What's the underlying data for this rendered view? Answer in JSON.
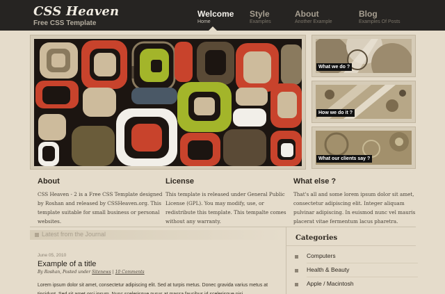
{
  "site": {
    "title": "CSS Heaven",
    "subtitle": "Free CSS Template"
  },
  "nav": [
    {
      "label": "Welcome",
      "sub": "Home",
      "active": true
    },
    {
      "label": "Style",
      "sub": "Examples"
    },
    {
      "label": "About",
      "sub": "Another Example"
    },
    {
      "label": "Blog",
      "sub": "Examples Of Posts"
    }
  ],
  "features": [
    {
      "caption": "What we do ?"
    },
    {
      "caption": "How we do it ?"
    },
    {
      "caption": "What our clients say ?"
    }
  ],
  "columns": [
    {
      "heading": "About",
      "text": "CSS Heaven - 2 is a Free CSS Template designed by Roshan and released by CSSHeaven.org. This template suitable for small business or personal websites."
    },
    {
      "heading": "License",
      "text": "This template is released under General Public License (GPL). You may modify, use, or redistribute this template. This tempalte comes without any warranty."
    },
    {
      "heading": "What else ?",
      "text": "That's all and some lorem ipsum dolor sit amet, consectetur adipiscing elit. Integer aliquam pulvinar adipiscing. In euismod nunc vel mauris placerat vitae fermentum lacus pharetra."
    }
  ],
  "journal": {
    "heading": "Latest from the Journal",
    "post": {
      "date": "June 05, 2010",
      "title": "Example of a title",
      "meta_prefix": "By Roshan, Posted under ",
      "category": "Sitenews",
      "separator": " | ",
      "comments": "10 Comments",
      "body": "Lorem ipsum dolor sit amet, consectetur adipiscing elit. Sed at turpis metus. Donec gravida varius metus at tincidunt. Sed sit amet orci ipsum. Nunc scelerisque purus at massa faucibus id scelerisque nisi."
    }
  },
  "sidebar": {
    "title": "Categories",
    "items": [
      {
        "label": "Computers"
      },
      {
        "label": "Health & Beauty"
      },
      {
        "label": "Apple / Macintosh"
      }
    ]
  },
  "colors": {
    "header": "#262422",
    "page": "#e5dccb",
    "accent_red": "#c8432c",
    "accent_green": "#a3b52a"
  }
}
